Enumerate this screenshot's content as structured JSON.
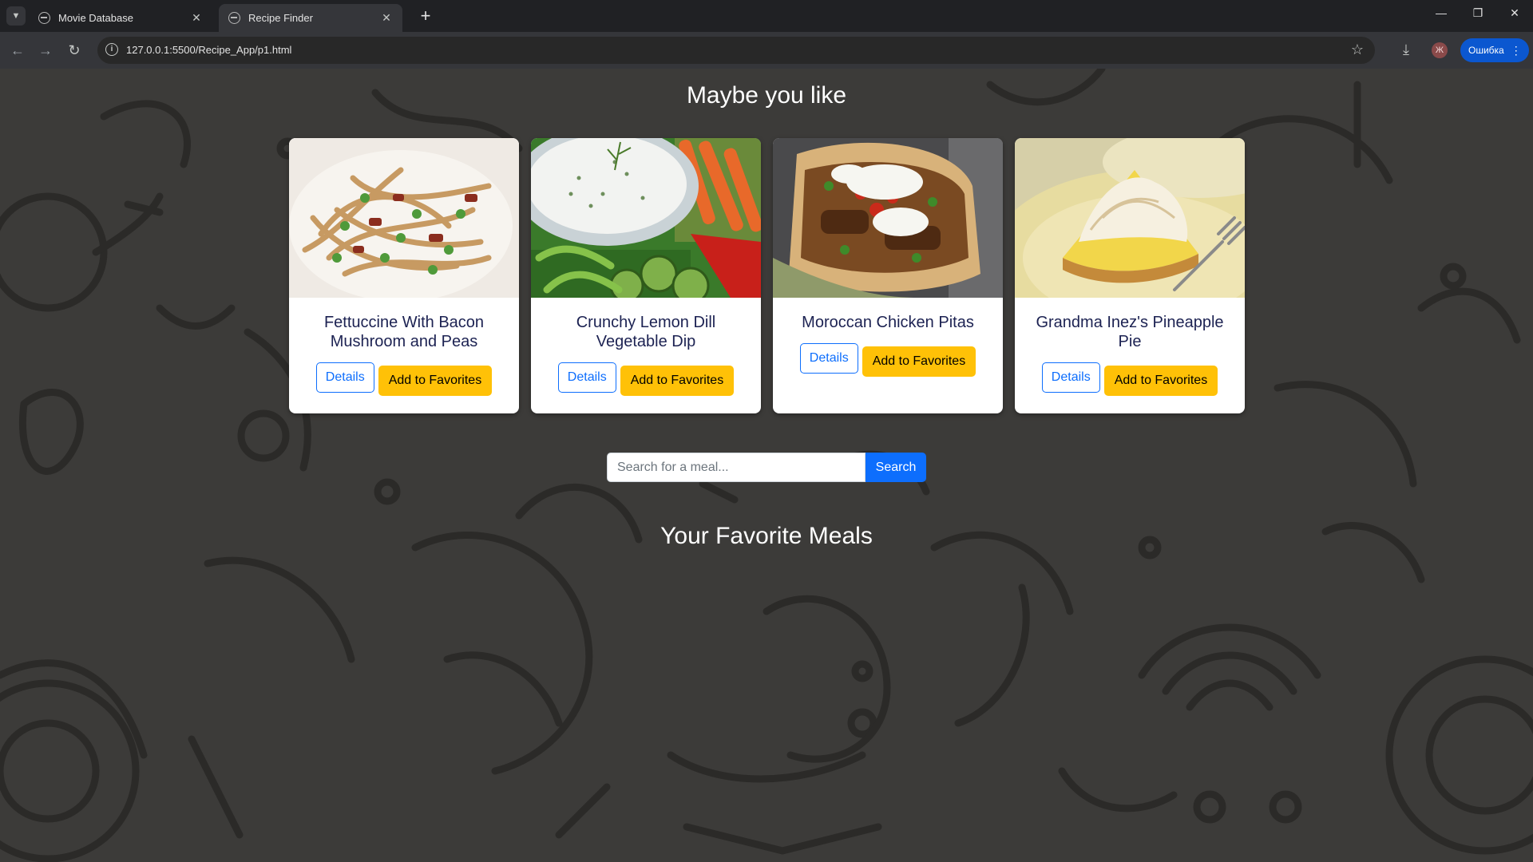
{
  "browser": {
    "tabs": [
      {
        "title": "Movie Database",
        "active": false
      },
      {
        "title": "Recipe Finder",
        "active": true
      }
    ],
    "url": "127.0.0.1:5500/Recipe_App/p1.html",
    "profile_initial": "Ж",
    "error_label": "Ошибка",
    "icons": {
      "tab_menu": "chevron-down-icon",
      "favicon": "globe-icon",
      "close": "close-icon",
      "new_tab": "plus-icon",
      "back": "arrow-left-icon",
      "forward": "arrow-right-icon",
      "reload": "reload-icon",
      "site_info": "info-icon",
      "bookmark": "star-icon",
      "downloads": "download-icon",
      "menu": "kebab-icon"
    }
  },
  "page": {
    "suggestions_heading": "Maybe you like",
    "cards": [
      {
        "title": "Fettuccine With Bacon Mushroom and Peas",
        "details_label": "Details",
        "favorite_label": "Add to Favorites"
      },
      {
        "title": "Crunchy Lemon Dill Vegetable Dip",
        "details_label": "Details",
        "favorite_label": "Add to Favorites"
      },
      {
        "title": "Moroccan Chicken Pitas",
        "details_label": "Details",
        "favorite_label": "Add to Favorites"
      },
      {
        "title": "Grandma Inez's Pineapple Pie",
        "details_label": "Details",
        "favorite_label": "Add to Favorites"
      }
    ],
    "search": {
      "placeholder": "Search for a meal...",
      "value": "",
      "button_label": "Search"
    },
    "favorites_heading": "Your Favorite Meals"
  },
  "colors": {
    "background": "#3c3b39",
    "pattern_stroke": "#2b2a28",
    "card_title": "#1c2252",
    "primary": "#0d6efd",
    "warning": "#ffc107"
  }
}
